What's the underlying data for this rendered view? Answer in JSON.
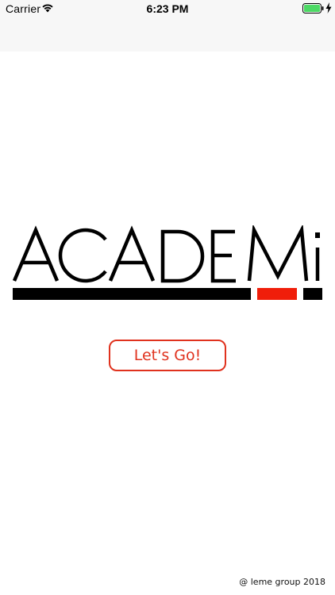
{
  "status_bar": {
    "carrier": "Carrier",
    "time": "6:23 PM",
    "wifi_icon": "wifi-icon",
    "battery_icon": "battery-icon",
    "charging_icon": "charging-bolt-icon",
    "battery_color": "#4cd964"
  },
  "logo": {
    "text": "ACADEMi",
    "bar_colors": {
      "black": "#000000",
      "red": "#f01e0a"
    }
  },
  "main": {
    "cta_label": "Let's Go!",
    "accent_color": "#e0321e"
  },
  "footer": {
    "copyright": "@ leme group 2018"
  }
}
